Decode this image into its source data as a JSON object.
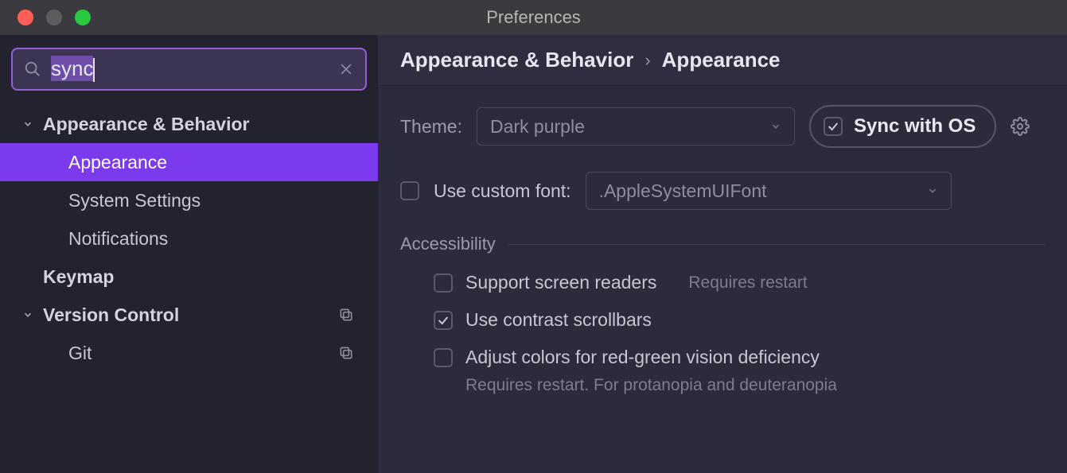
{
  "window": {
    "title": "Preferences"
  },
  "search": {
    "value": "sync"
  },
  "sidebar": {
    "groups": [
      {
        "label": "Appearance & Behavior",
        "items": [
          {
            "label": "Appearance",
            "selected": true
          },
          {
            "label": "System Settings"
          },
          {
            "label": "Notifications"
          }
        ]
      },
      {
        "label": "Keymap",
        "items": []
      },
      {
        "label": "Version Control",
        "items": [
          {
            "label": "Git"
          }
        ]
      }
    ]
  },
  "breadcrumb": {
    "parent": "Appearance & Behavior",
    "child": "Appearance"
  },
  "theme": {
    "label": "Theme:",
    "value": "Dark purple",
    "sync_label": "Sync with OS",
    "sync_checked": true
  },
  "font": {
    "checkbox_label": "Use custom font:",
    "checked": false,
    "value": ".AppleSystemUIFont"
  },
  "accessibility": {
    "title": "Accessibility",
    "options": [
      {
        "label": "Support screen readers",
        "checked": false,
        "hint": "Requires restart"
      },
      {
        "label": "Use contrast scrollbars",
        "checked": true
      },
      {
        "label": "Adjust colors for red-green vision deficiency",
        "checked": false,
        "desc": "Requires restart. For protanopia and deuteranopia"
      }
    ]
  }
}
